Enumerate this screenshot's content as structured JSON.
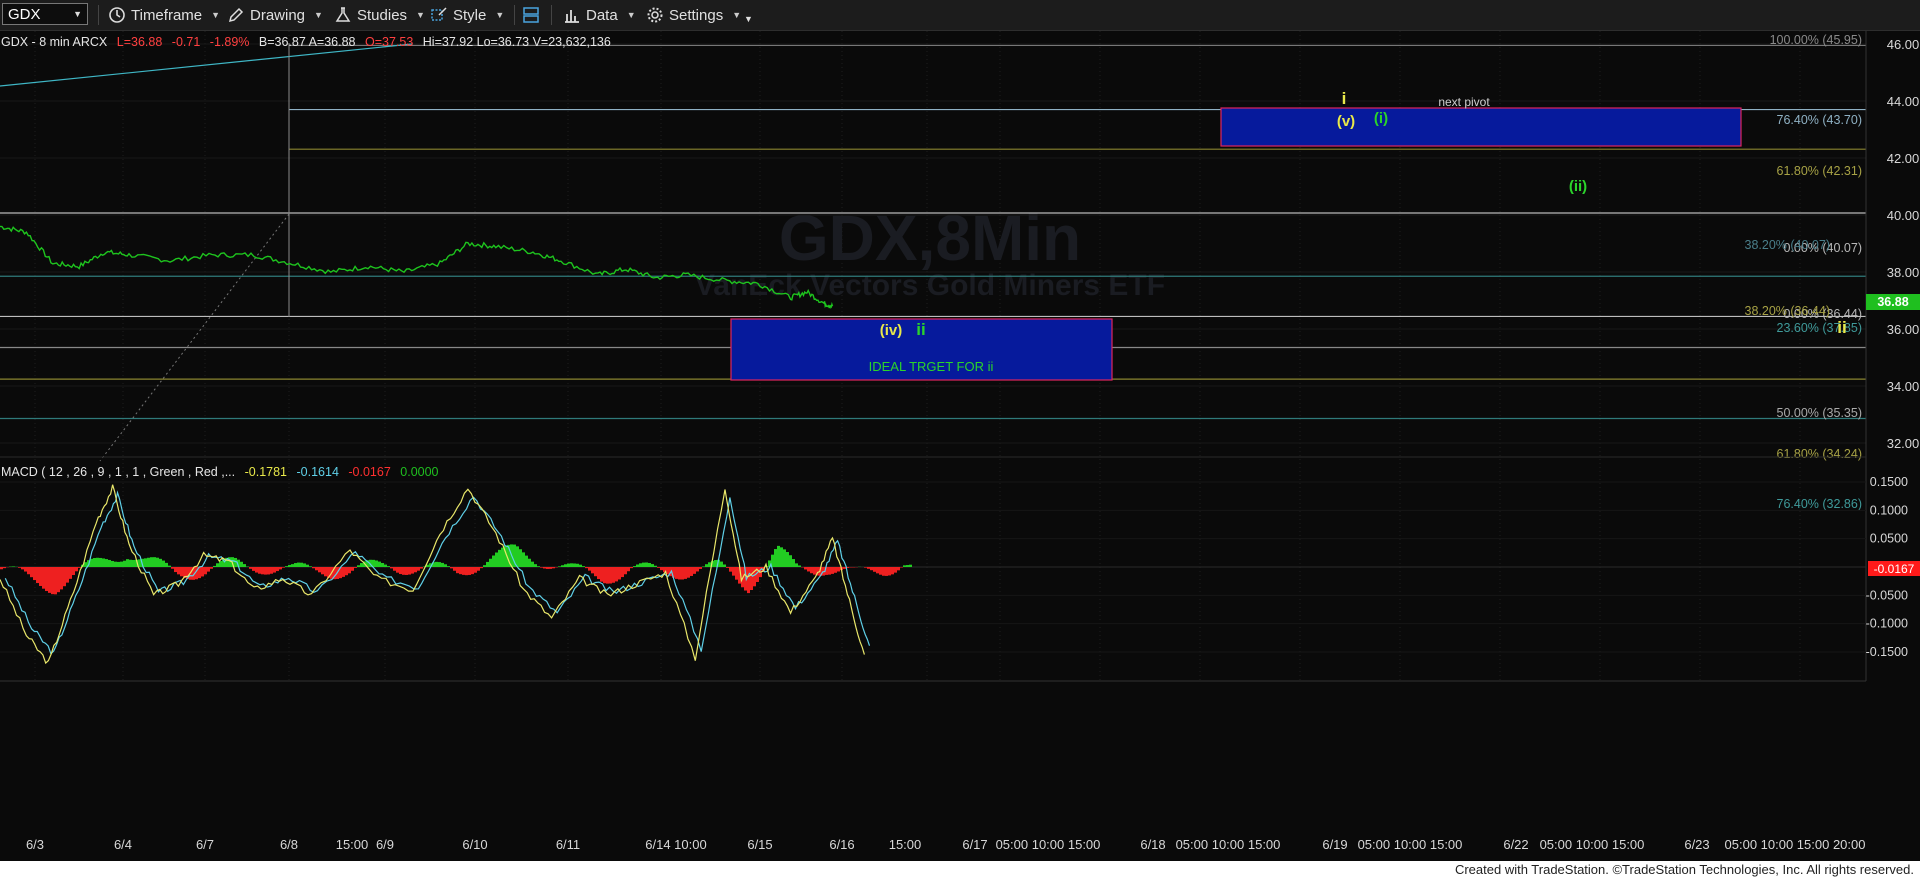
{
  "toolbar": {
    "symbol": "GDX",
    "timeframe": "Timeframe",
    "drawing": "Drawing",
    "studies": "Studies",
    "style": "Style",
    "data": "Data",
    "settings": "Settings"
  },
  "header": {
    "title": "GDX - 8 min  ARCX",
    "L": "L=36.88",
    "chg": "-0.71",
    "pct": "-1.89%",
    "rest": "B=36.87  A=36.88",
    "O": "O=37.53",
    "tail": "Hi=37.92  Lo=36.73  V=23,632,136"
  },
  "watermark": {
    "line1": "GDX,8Min",
    "line2": "VanEck Vectors Gold Miners ETF"
  },
  "price_axis": {
    "labels": [
      "46.00",
      "44.00",
      "42.00",
      "40.00",
      "38.00",
      "36.00",
      "34.00",
      "32.00"
    ]
  },
  "last_price": "36.88",
  "fib": [
    {
      "text": "100.00% (45.95)",
      "color": "#8a8a8a"
    },
    {
      "text": "76.40% (43.70)",
      "color": "#8fb1c4"
    },
    {
      "text": "61.80% (42.31)",
      "color": "#a7a245"
    },
    {
      "text": "0.00% (40.07)",
      "color": "#b9b9b9"
    },
    {
      "text": "38.20% (40.07)",
      "color": "#4a7e8a"
    },
    {
      "text": "23.60% (37.85)",
      "color": "#3f9a9a"
    },
    {
      "text": "0.00% (36.44)",
      "color": "#b9b9b9"
    },
    {
      "text": "38.20% (36.44)",
      "color": "#a7a245"
    },
    {
      "text": "50.00% (35.35)",
      "color": "#aaaaaa"
    },
    {
      "text": "61.80% (34.24)",
      "color": "#a7a245"
    },
    {
      "text": "76.40% (32.86)",
      "color": "#3f9a9a"
    }
  ],
  "annotations": {
    "top_i": "i",
    "v": "(v)",
    "i_green": "(i)",
    "ii_green": "(ii)",
    "iv": "(iv)",
    "ii_box": "ii",
    "ii_right": "ii",
    "next_pivot": "next pivot",
    "target": "IDEAL TRGET FOR ii"
  },
  "macd": {
    "title": "MACD ( 12 , 26 , 9 , 1 , 1 , Green , Red ,...",
    "v1": "-0.1781",
    "v2": "-0.1614",
    "v3": "-0.0167",
    "v4": "0.0000",
    "axis": [
      "0.1500",
      "0.1000",
      "0.0500",
      "0.0000",
      "-0.0500",
      "-0.1000",
      "-0.1500"
    ],
    "last": "-0.0167"
  },
  "time_axis": {
    "labels": [
      "6/3",
      "6/4",
      "6/7",
      "6/8",
      "15:00",
      "6/9",
      "6/10",
      "6/11",
      "6/14 10:00",
      "6/15",
      "6/16",
      "15:00",
      "6/17",
      "05:00 10:00 15:00",
      "6/18",
      "05:00 10:00 15:00",
      "6/19",
      "05:00 10:00 15:00",
      "6/22",
      "05:00 10:00 15:00",
      "6/23",
      "05:00 10:00 15:00 20:00"
    ]
  },
  "footer": "Created with TradeStation. ©TradeStation Technologies, Inc. All rights reserved.",
  "chart_data": [
    {
      "type": "line",
      "title": "GDX - 8 min",
      "x_categories": [
        "6/3",
        "6/4",
        "6/7",
        "6/8",
        "6/9",
        "6/10",
        "6/11",
        "6/14",
        "6/15",
        "6/16"
      ],
      "ylim": [
        31,
        46.2
      ],
      "y_ticks": [
        46,
        44,
        42,
        40,
        38,
        36,
        34,
        32
      ],
      "price_path": [
        [
          0,
          39.6
        ],
        [
          0.3,
          39.4
        ],
        [
          0.6,
          38.3
        ],
        [
          0.9,
          38.2
        ],
        [
          1.2,
          38.7
        ],
        [
          1.5,
          38.6
        ],
        [
          2.0,
          38.4
        ],
        [
          2.5,
          38.6
        ],
        [
          3.0,
          38.6
        ],
        [
          3.4,
          38.3
        ],
        [
          3.8,
          38.0
        ],
        [
          4.2,
          38.2
        ],
        [
          4.6,
          38.0
        ],
        [
          5.0,
          38.3
        ],
        [
          5.3,
          39.0
        ],
        [
          5.6,
          38.9
        ],
        [
          6.0,
          38.7
        ],
        [
          6.3,
          38.4
        ],
        [
          6.7,
          37.9
        ],
        [
          7.0,
          38.1
        ],
        [
          7.3,
          37.8
        ],
        [
          7.6,
          37.9
        ],
        [
          8.0,
          37.7
        ],
        [
          8.4,
          37.6
        ],
        [
          8.8,
          37.1
        ],
        [
          9.0,
          37.3
        ],
        [
          9.2,
          36.9
        ],
        [
          9.3,
          36.8
        ]
      ],
      "fib_levels": [
        45.95,
        43.7,
        42.31,
        40.07,
        37.85,
        36.44,
        35.35,
        34.24,
        32.86
      ],
      "boxes": [
        {
          "label": "next pivot",
          "low": 42.31,
          "high": 43.7
        },
        {
          "label": "IDEAL TRGET FOR ii",
          "low": 34.24,
          "high": 36.44
        }
      ],
      "last": 36.88
    },
    {
      "type": "line",
      "title": "MACD",
      "ylim": [
        -0.18,
        0.18
      ],
      "y_ticks": [
        0.15,
        0.1,
        0.05,
        0.0,
        -0.05,
        -0.1,
        -0.15
      ],
      "series": [
        {
          "name": "MACD",
          "color": "#e9e76a",
          "last": -0.1781
        },
        {
          "name": "Signal",
          "color": "#5fd0e8",
          "last": -0.1614
        },
        {
          "name": "Hist",
          "color": "#20c020",
          "last": -0.0167
        }
      ],
      "macd_path": [
        [
          0,
          -0.02
        ],
        [
          0.3,
          -0.12
        ],
        [
          0.55,
          -0.17
        ],
        [
          0.8,
          -0.06
        ],
        [
          1.1,
          0.08
        ],
        [
          1.3,
          0.14
        ],
        [
          1.5,
          0.04
        ],
        [
          1.8,
          -0.05
        ],
        [
          2.1,
          -0.03
        ],
        [
          2.4,
          0.02
        ],
        [
          2.7,
          0.01
        ],
        [
          3.0,
          -0.04
        ],
        [
          3.3,
          -0.02
        ],
        [
          3.6,
          -0.05
        ],
        [
          4.0,
          0.03
        ],
        [
          4.3,
          -0.02
        ],
        [
          4.7,
          -0.04
        ],
        [
          5.0,
          0.06
        ],
        [
          5.3,
          0.14
        ],
        [
          5.6,
          0.06
        ],
        [
          5.9,
          -0.04
        ],
        [
          6.2,
          -0.09
        ],
        [
          6.5,
          -0.02
        ],
        [
          6.8,
          -0.05
        ],
        [
          7.1,
          -0.03
        ],
        [
          7.4,
          -0.01
        ],
        [
          7.7,
          -0.16
        ],
        [
          8.0,
          0.14
        ],
        [
          8.2,
          -0.02
        ],
        [
          8.5,
          0.0
        ],
        [
          8.8,
          -0.08
        ],
        [
          9.1,
          -0.02
        ],
        [
          9.3,
          0.05
        ],
        [
          9.5,
          -0.06
        ],
        [
          9.7,
          -0.17
        ]
      ]
    }
  ]
}
